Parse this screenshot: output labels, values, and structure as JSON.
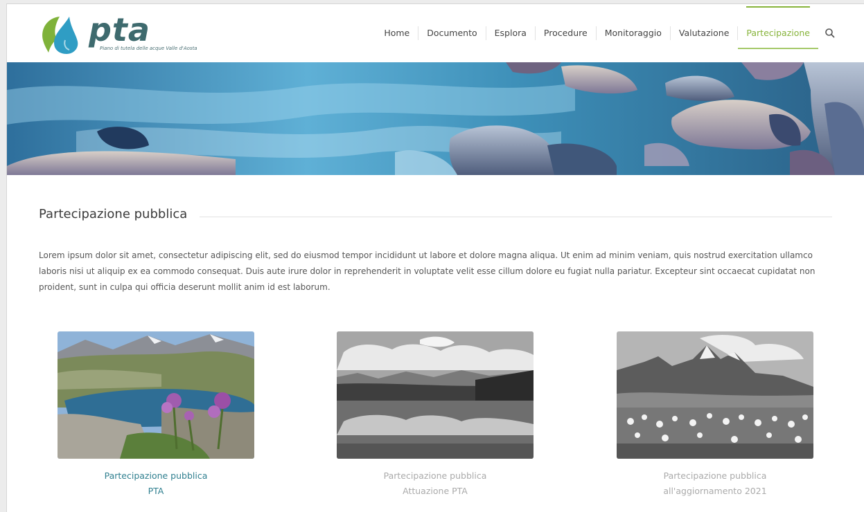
{
  "brand": {
    "name": "pta",
    "tagline": "Piano di tutela delle acque Valle d'Aosta",
    "colors": {
      "accent": "#86b33a",
      "logo_text": "#3e6a6e",
      "link": "#2f7f8f",
      "muted_text": "#aaaaaa"
    }
  },
  "nav": {
    "items": [
      {
        "label": "Home",
        "active": false
      },
      {
        "label": "Documento",
        "active": false
      },
      {
        "label": "Esplora",
        "active": false
      },
      {
        "label": "Procedure",
        "active": false
      },
      {
        "label": "Monitoraggio",
        "active": false
      },
      {
        "label": "Valutazione",
        "active": false
      },
      {
        "label": "Partecipazione",
        "active": true
      }
    ],
    "search_icon": "search-icon"
  },
  "main": {
    "title": "Partecipazione pubblica",
    "intro": "Lorem ipsum dolor sit amet, consectetur adipiscing elit, sed do eiusmod tempor incididunt ut labore et dolore magna aliqua. Ut enim ad minim veniam, quis nostrud exercitation ullamco laboris nisi ut aliquip ex ea commodo consequat. Duis aute irure dolor in reprehenderit in voluptate velit esse cillum dolore eu fugiat nulla pariatur. Excepteur sint occaecat cupidatat non proident, sunt in culpa qui officia deserunt mollit anim id est laborum."
  },
  "cards": [
    {
      "line1": "Partecipazione pubblica",
      "line2": "PTA",
      "image": "mountain-lake-flowers-color"
    },
    {
      "line1": "Partecipazione pubblica",
      "line2": "Attuazione PTA",
      "image": "lake-reflection-grayscale"
    },
    {
      "line1": "Partecipazione pubblica",
      "line2": "all'aggiornamento 2021",
      "image": "mountain-lake-cotton-grass-grayscale"
    }
  ]
}
